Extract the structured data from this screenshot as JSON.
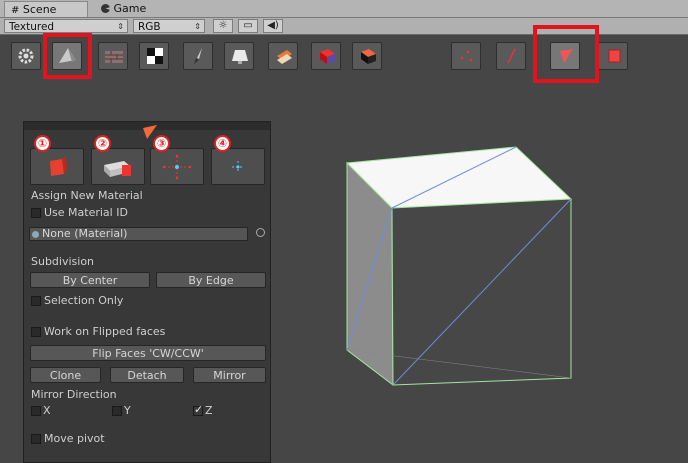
{
  "tabs": [
    {
      "label": "Scene",
      "icon": "grid-icon"
    },
    {
      "label": "Game",
      "icon": "pacman-icon"
    }
  ],
  "controls": {
    "shading_mode": "Textured",
    "render_mode": "RGB"
  },
  "panel": {
    "step_badges": [
      "①",
      "②",
      "③",
      "④"
    ],
    "assign_new_material": "Assign New Material",
    "use_material_id": "Use Material ID",
    "material_value": "None (Material)",
    "subdivision": "Subdivision",
    "by_center": "By Center",
    "by_edge": "By Edge",
    "selection_only": "Selection Only",
    "work_on_flipped": "Work on Flipped faces",
    "flip_faces": "Flip Faces 'CW/CCW'",
    "clone": "Clone",
    "detach": "Detach",
    "mirror": "Mirror",
    "mirror_direction": "Mirror Direction",
    "axis_x": "X",
    "axis_y": "Y",
    "axis_z": "Z",
    "move_pivot": "Move pivot"
  },
  "colors": {
    "highlight": "#e1141e",
    "viewport": "#464646",
    "panel": "#383838"
  }
}
